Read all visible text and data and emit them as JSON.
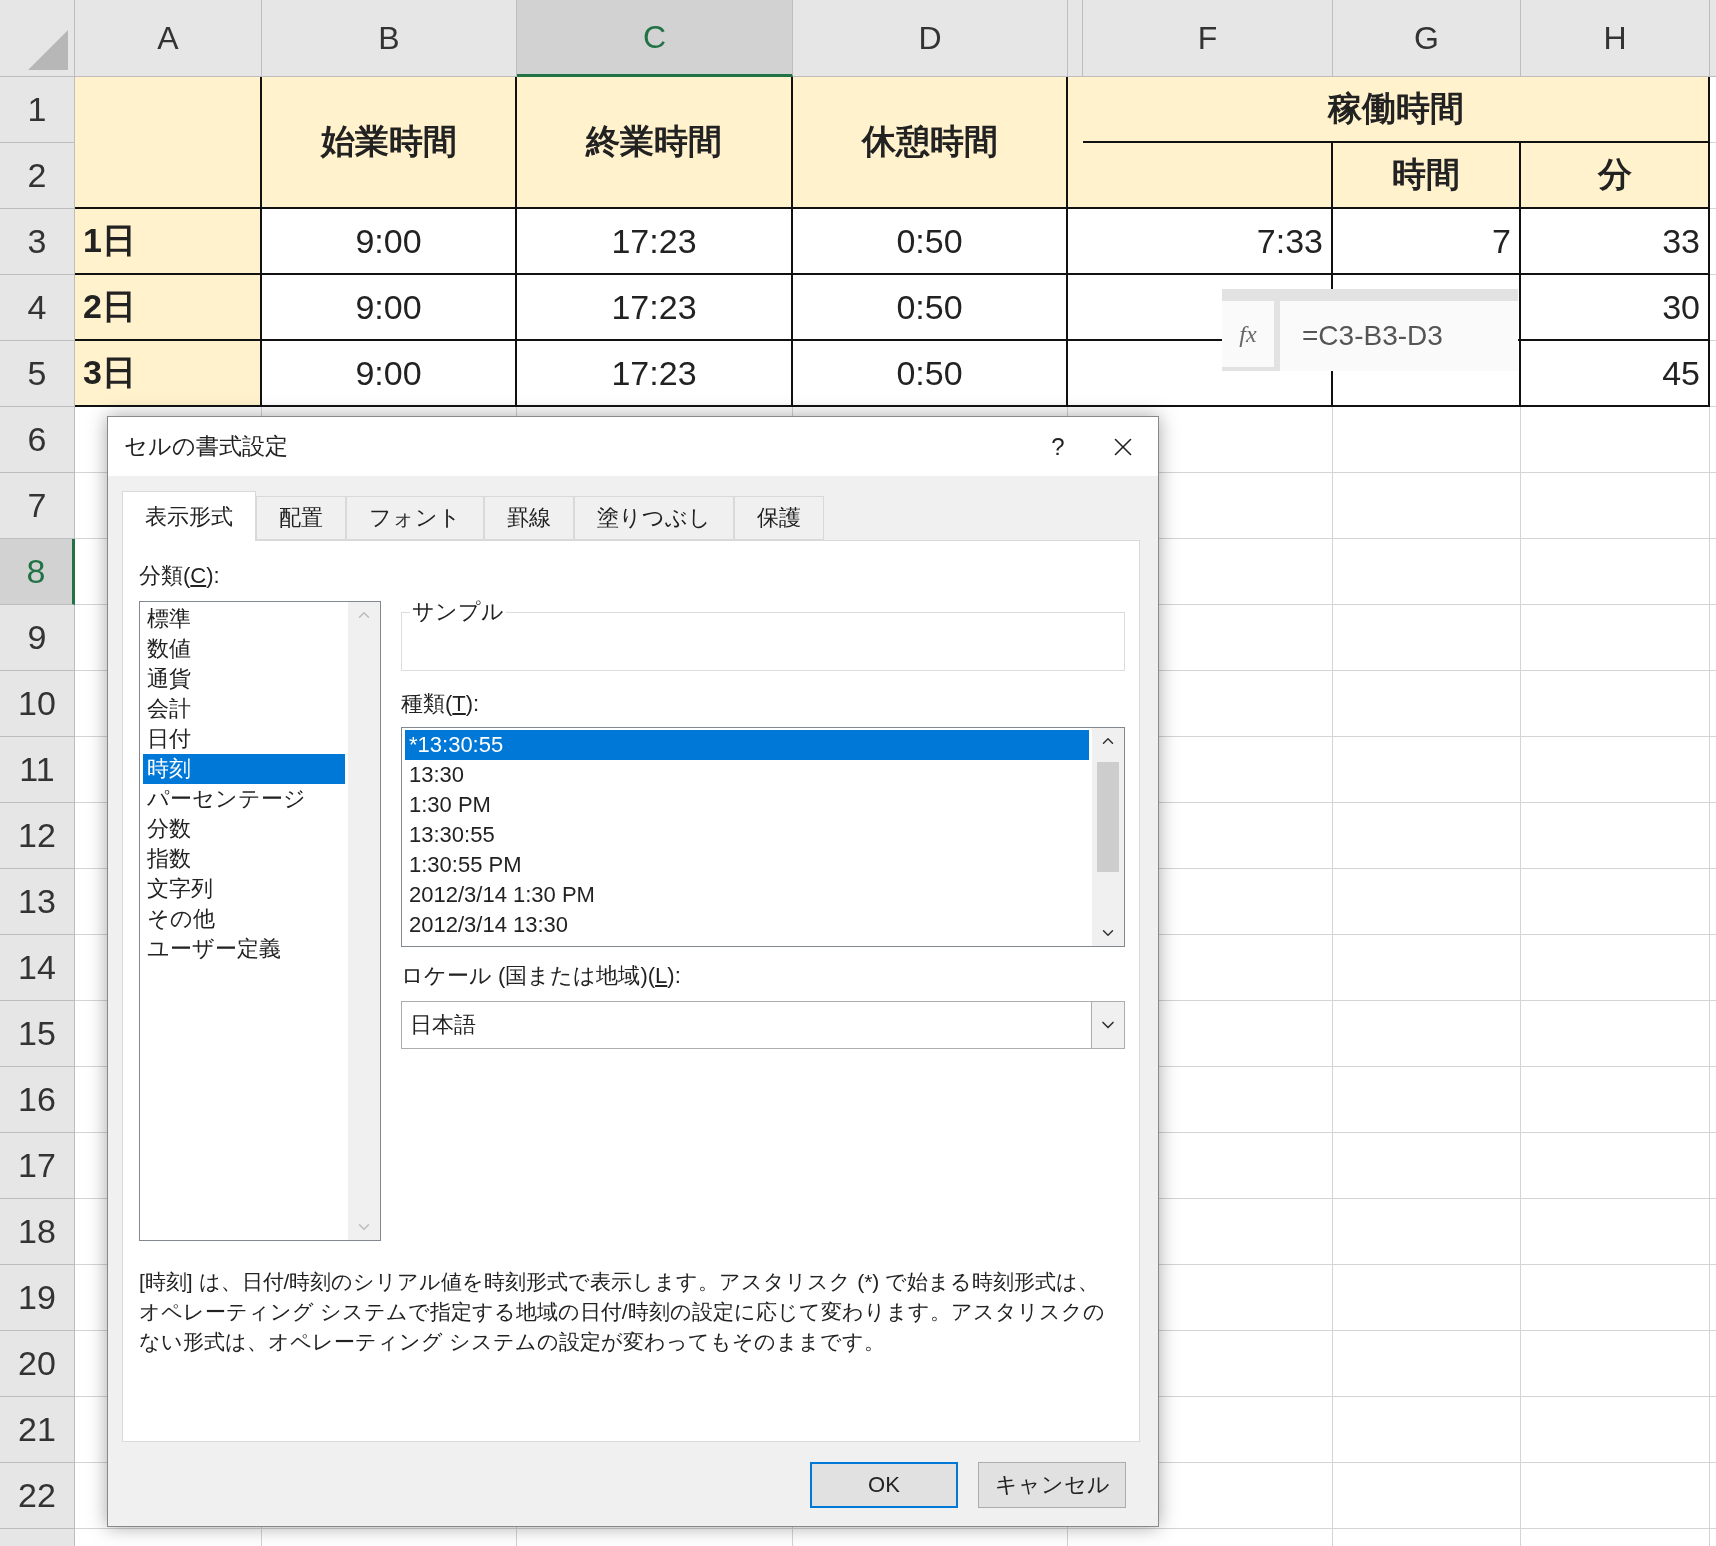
{
  "sheet": {
    "columns": [
      {
        "label": "A",
        "selected": false
      },
      {
        "label": "B",
        "selected": false
      },
      {
        "label": "C",
        "selected": true
      },
      {
        "label": "D",
        "selected": false
      },
      {
        "label": "F",
        "selected": false
      },
      {
        "label": "G",
        "selected": false
      },
      {
        "label": "H",
        "selected": false
      }
    ],
    "rows": [
      {
        "label": "1",
        "selected": false
      },
      {
        "label": "2",
        "selected": false
      },
      {
        "label": "3",
        "selected": false
      },
      {
        "label": "4",
        "selected": false
      },
      {
        "label": "5",
        "selected": false
      },
      {
        "label": "6",
        "selected": false
      },
      {
        "label": "7",
        "selected": false
      },
      {
        "label": "8",
        "selected": true
      },
      {
        "label": "9",
        "selected": false
      },
      {
        "label": "10",
        "selected": false
      },
      {
        "label": "11",
        "selected": false
      },
      {
        "label": "12",
        "selected": false
      },
      {
        "label": "13",
        "selected": false
      },
      {
        "label": "14",
        "selected": false
      },
      {
        "label": "15",
        "selected": false
      },
      {
        "label": "16",
        "selected": false
      },
      {
        "label": "17",
        "selected": false
      },
      {
        "label": "18",
        "selected": false
      },
      {
        "label": "19",
        "selected": false
      },
      {
        "label": "20",
        "selected": false
      },
      {
        "label": "21",
        "selected": false
      },
      {
        "label": "22",
        "selected": false
      }
    ],
    "header": {
      "start": "始業時間",
      "end": "終業時間",
      "break": "休憩時間",
      "worked": "稼働時間",
      "hours": "時間",
      "minutes": "分"
    },
    "records": [
      {
        "day": "1日",
        "start": "9:00",
        "end": "17:23",
        "break": "0:50",
        "worked": "7:33",
        "hours": "7",
        "minutes": "33"
      },
      {
        "day": "2日",
        "start": "9:00",
        "end": "17:23",
        "break": "0:50",
        "minutes": "30"
      },
      {
        "day": "3日",
        "start": "9:00",
        "end": "17:23",
        "break": "0:50",
        "minutes": "45"
      }
    ]
  },
  "formula_tip": {
    "fx": "fx",
    "formula": "=C3-B3-D3"
  },
  "dialog": {
    "title": "セルの書式設定",
    "help": "?",
    "tabs": [
      {
        "label": "表示形式",
        "selected": true
      },
      {
        "label": "配置",
        "selected": false
      },
      {
        "label": "フォント",
        "selected": false
      },
      {
        "label": "罫線",
        "selected": false
      },
      {
        "label": "塗りつぶし",
        "selected": false
      },
      {
        "label": "保護",
        "selected": false
      }
    ],
    "category_label": {
      "prefix": "分類(",
      "key": "C",
      "suffix": "):"
    },
    "categories": [
      {
        "label": "標準",
        "selected": false
      },
      {
        "label": "数値",
        "selected": false
      },
      {
        "label": "通貨",
        "selected": false
      },
      {
        "label": "会計",
        "selected": false
      },
      {
        "label": "日付",
        "selected": false
      },
      {
        "label": "時刻",
        "selected": true
      },
      {
        "label": "パーセンテージ",
        "selected": false
      },
      {
        "label": "分数",
        "selected": false
      },
      {
        "label": "指数",
        "selected": false
      },
      {
        "label": "文字列",
        "selected": false
      },
      {
        "label": "その他",
        "selected": false
      },
      {
        "label": "ユーザー定義",
        "selected": false
      }
    ],
    "sample_label": "サンプル",
    "type_label": {
      "prefix": "種類(",
      "key": "T",
      "suffix": "):"
    },
    "types": [
      {
        "label": "*13:30:55",
        "selected": true
      },
      {
        "label": "13:30",
        "selected": false
      },
      {
        "label": "1:30 PM",
        "selected": false
      },
      {
        "label": "13:30:55",
        "selected": false
      },
      {
        "label": "1:30:55 PM",
        "selected": false
      },
      {
        "label": "2012/3/14 1:30 PM",
        "selected": false
      },
      {
        "label": "2012/3/14 13:30",
        "selected": false
      }
    ],
    "locale_label": {
      "prefix": "ロケール (国または地域)(",
      "key": "L",
      "suffix": "):"
    },
    "locale": "日本語",
    "description": "[時刻] は、日付/時刻のシリアル値を時刻形式で表示します。アスタリスク (*) で始まる時刻形式は、オペレーティング システムで指定する地域の日付/時刻の設定に応じて変わります。アスタリスクのない形式は、オペレーティング システムの設定が変わってもそのままです。",
    "buttons": [
      {
        "label": "OK",
        "default": true
      },
      {
        "label": "キャンセル",
        "default": false
      }
    ]
  }
}
